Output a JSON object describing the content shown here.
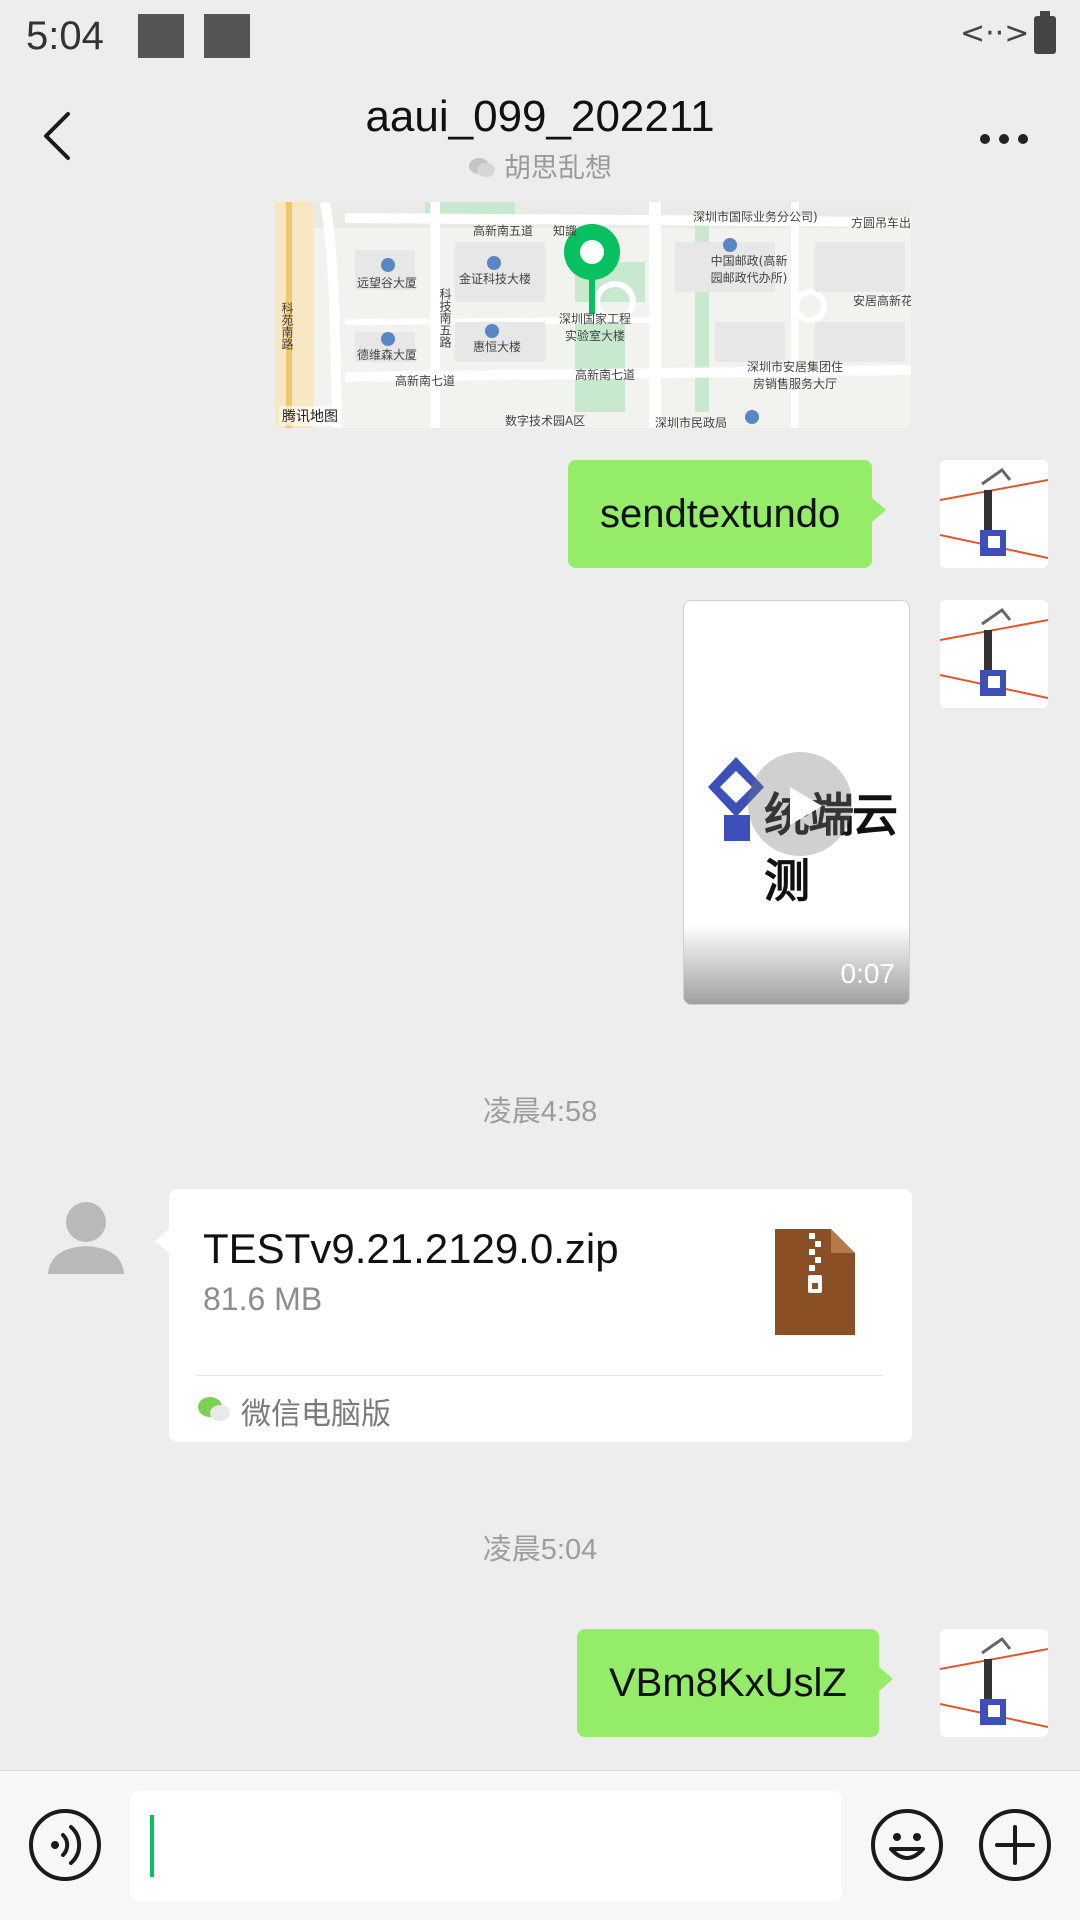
{
  "status_bar": {
    "time": "5:04",
    "data_indicator": "<··>",
    "battery_icon": "battery-icon"
  },
  "header": {
    "title": "aaui_099_202211",
    "subtitle": "胡思乱想",
    "back_icon": "chevron-left-icon",
    "more_icon": "more-horizontal-icon"
  },
  "map_message": {
    "labels": [
      "高新南五道",
      "知識",
      "远望谷大厦",
      "金证科技大楼",
      "科技南五路",
      "深圳国家工程实验室大楼",
      "德维森大厦",
      "惠恒大楼",
      "高新南七道",
      "高新南七道",
      "中国邮政(高新园邮政代办所)",
      "深圳市国际业务分公司)",
      "方圆吊车出",
      "安居高新花",
      "深圳市安居集团住房销售服务大厅",
      "科苑南路",
      "数字技术园A区",
      "深圳市民政局"
    ],
    "provider": "腾讯地图"
  },
  "messages": [
    {
      "type": "text",
      "from": "me",
      "text": "sendtextundo"
    },
    {
      "type": "video",
      "from": "me",
      "duration": "0:07",
      "thumbnail_text": "统端云测"
    },
    {
      "type": "timestamp",
      "text": "凌晨4:58"
    },
    {
      "type": "file",
      "from": "other",
      "file_name": "TESTv9.21.2129.0.zip",
      "file_size": "81.6 MB",
      "source": "微信电脑版"
    },
    {
      "type": "timestamp",
      "text": "凌晨5:04"
    },
    {
      "type": "text",
      "from": "me",
      "text": "VBm8KxUslZ"
    }
  ],
  "input_bar": {
    "voice_icon": "voice-icon",
    "input_value": "",
    "emoji_icon": "emoji-icon",
    "plus_icon": "plus-icon"
  },
  "colors": {
    "bubble_green": "#95ec69",
    "accent_green": "#07c160",
    "background": "#ededed"
  }
}
